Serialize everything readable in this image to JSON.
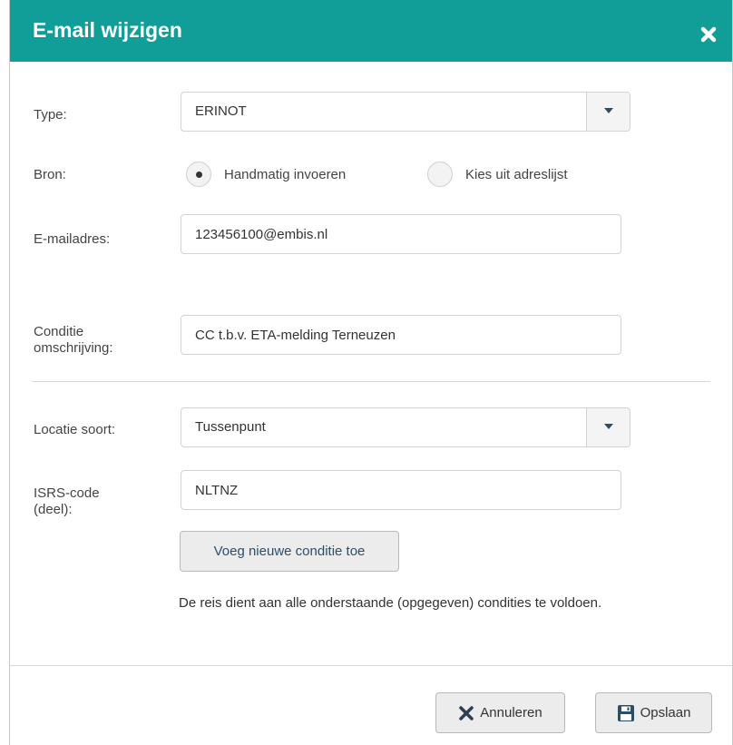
{
  "dialog": {
    "title": "E-mail wijzigen",
    "close_icon": "close-icon",
    "header_color": "#119e99"
  },
  "form": {
    "type": {
      "label": "Type:",
      "value": "ERINOT"
    },
    "source": {
      "label": "Bron:",
      "options": [
        {
          "label": "Handmatig invoeren",
          "selected": true
        },
        {
          "label": "Kies uit adreslijst",
          "selected": false
        }
      ]
    },
    "email": {
      "label": "E-mailadres:",
      "value": "123456100@embis.nl"
    },
    "condition": {
      "label_line1": "Conditie",
      "label_line2": "omschrijving:",
      "value": "CC t.b.v. ETA-melding Terneuzen"
    },
    "location_type": {
      "label": "Locatie soort:",
      "value": "Tussenpunt"
    },
    "isrs": {
      "label_line1": "ISRS-code",
      "label_line2": "(deel):",
      "value": "NLTNZ"
    },
    "add_condition_label": "Voeg nieuwe conditie toe",
    "note": "De reis dient aan alle onderstaande (opgegeven) condities te voldoen."
  },
  "footer": {
    "cancel_label": "Annuleren",
    "save_label": "Opslaan"
  }
}
